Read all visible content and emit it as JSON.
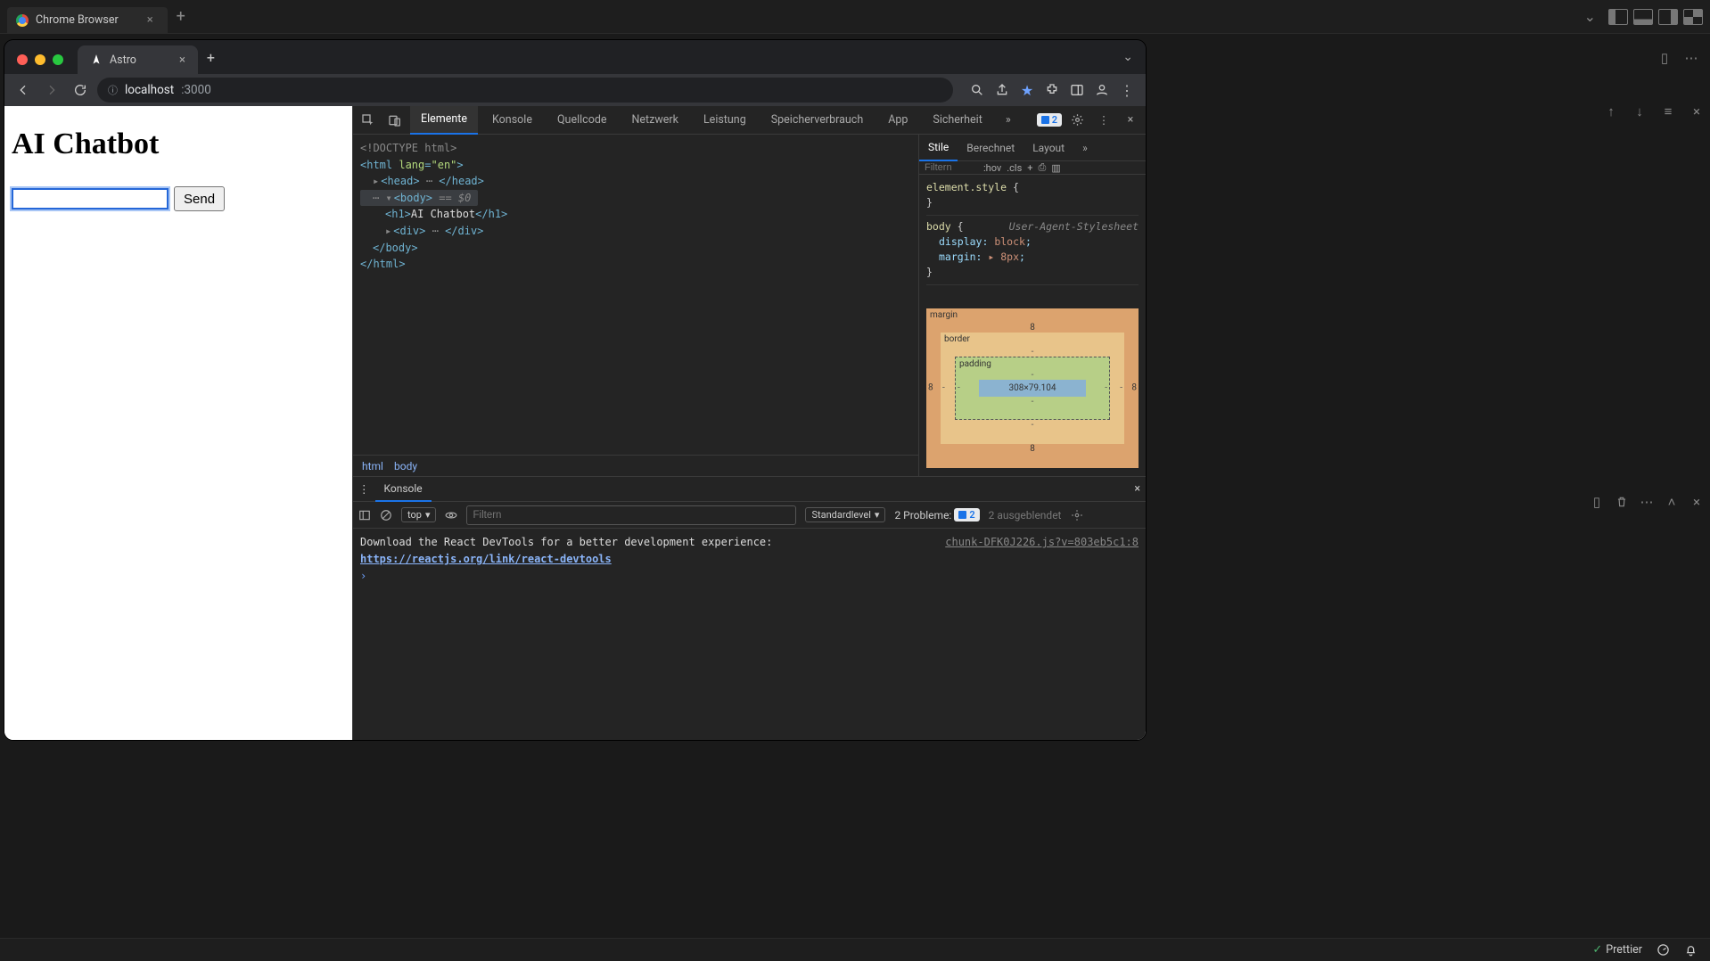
{
  "outer_editor": {
    "tab_title": "Chrome Browser",
    "layout_icons": [
      "panel-left",
      "panel-bottom",
      "panel-right",
      "layout-grid"
    ]
  },
  "chrome": {
    "tab_title": "Astro",
    "url_host": "localhost",
    "url_rest": ":3000",
    "toolbar_icons": [
      "zoom-icon",
      "share-icon",
      "bookmark-star-icon",
      "extensions-icon",
      "side-panel-icon",
      "profile-icon",
      "more-icon"
    ]
  },
  "page": {
    "heading": "AI Chatbot",
    "send_label": "Send"
  },
  "devtools": {
    "tabs": [
      "Elemente",
      "Konsole",
      "Quellcode",
      "Netzwerk",
      "Leistung",
      "Speicherverbrauch",
      "App",
      "Sicherheit"
    ],
    "active_tab": "Elemente",
    "issues_badge": "2",
    "dom": {
      "doctype": "<!DOCTYPE html>",
      "html_open": "<html lang=\"en\">",
      "head_collapsed": "<head> ⋯ </head>",
      "body_open": "<body>",
      "body_selected_suffix": " == $0",
      "h1_text": "AI Chatbot",
      "div_collapsed": "<div> ⋯ </div>",
      "body_close": "</body>",
      "html_close": "</html>"
    },
    "breadcrumb": [
      "html",
      "body"
    ],
    "styles": {
      "subtabs": [
        "Stile",
        "Berechnet",
        "Layout"
      ],
      "filter_placeholder": "Filtern",
      "hov_label": ":hov",
      "cls_label": ".cls",
      "element_style_selector": "element.style",
      "body_selector": "body",
      "ua_label": "User-Agent-Stylesheet",
      "props": [
        {
          "name": "display",
          "value": "block"
        },
        {
          "name": "margin",
          "value": "▸ 8px"
        }
      ]
    },
    "box_model": {
      "margin_label": "margin",
      "border_label": "border",
      "padding_label": "padding",
      "content": "308×79.104",
      "margin_values": {
        "top": "8",
        "right": "8",
        "bottom": "8",
        "left": "8"
      },
      "border_values": {
        "all": "-"
      },
      "padding_values": {
        "all": "-"
      }
    },
    "drawer": {
      "tab": "Konsole",
      "context": "top",
      "filter_placeholder": "Filtern",
      "level_label": "Standardlevel",
      "problems_label": "2 Probleme:",
      "problems_count": "2",
      "hidden_label": "2 ausgeblendet",
      "log_source": "chunk-DFK0J226.js?v=803eb5c1:8",
      "log_msg": "Download the React DevTools for a better development experience: ",
      "log_link": "https://reactjs.org/link/react-devtools"
    }
  },
  "vscode": {
    "status_prettier": "Prettier"
  }
}
